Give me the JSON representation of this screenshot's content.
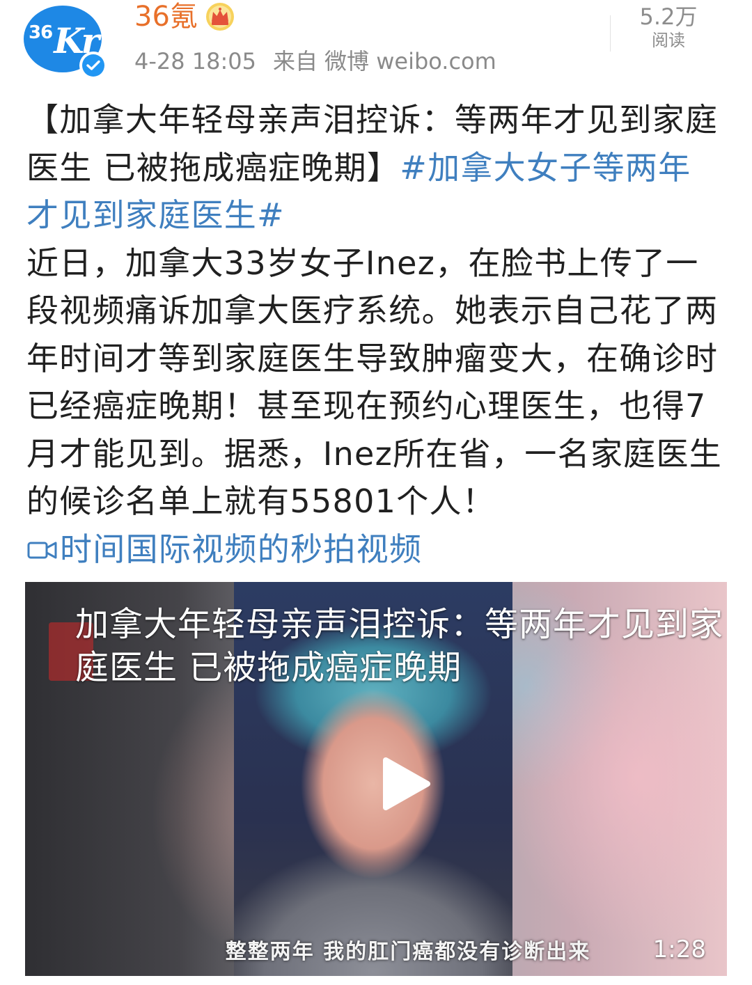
{
  "author": {
    "avatar_text_1": "36",
    "avatar_text_2": "Kr",
    "name": "36氪",
    "verified": true
  },
  "meta": {
    "timestamp": "4-28 18:05",
    "from_label": "来自",
    "source": "微博 weibo.com"
  },
  "reads": {
    "count": "5.2万",
    "label": "阅读"
  },
  "post": {
    "headline": "【加拿大年轻母亲声泪控诉：等两年才见到家庭医生 已被拖成癌症晚期】",
    "topic": "#加拿大女子等两年才见到家庭医生#",
    "body": "近日，加拿大33岁女子Inez，在脸书上传了一段视频痛诉加拿大医疗系统。她表示自己花了两年时间才等到家庭医生导致肿瘤变大，在确诊时已经癌症晚期！甚至现在预约心理医生，也得7月才能见到。据悉，Inez所在省，一名家庭医生的候诊名单上就有55801个人！",
    "video_link": "时间国际视频的秒拍视频"
  },
  "video": {
    "title": "加拿大年轻母亲声泪控诉：等两年才见到家庭医生 已被拖成癌症晚期",
    "subtitle": "整整两年 我的肛门癌都没有诊断出来",
    "duration": "1:28"
  },
  "colors": {
    "username": "#e8702a",
    "link": "#3f7fbf",
    "meta": "#8a8a8a",
    "avatar_bg": "#1e88e5"
  }
}
